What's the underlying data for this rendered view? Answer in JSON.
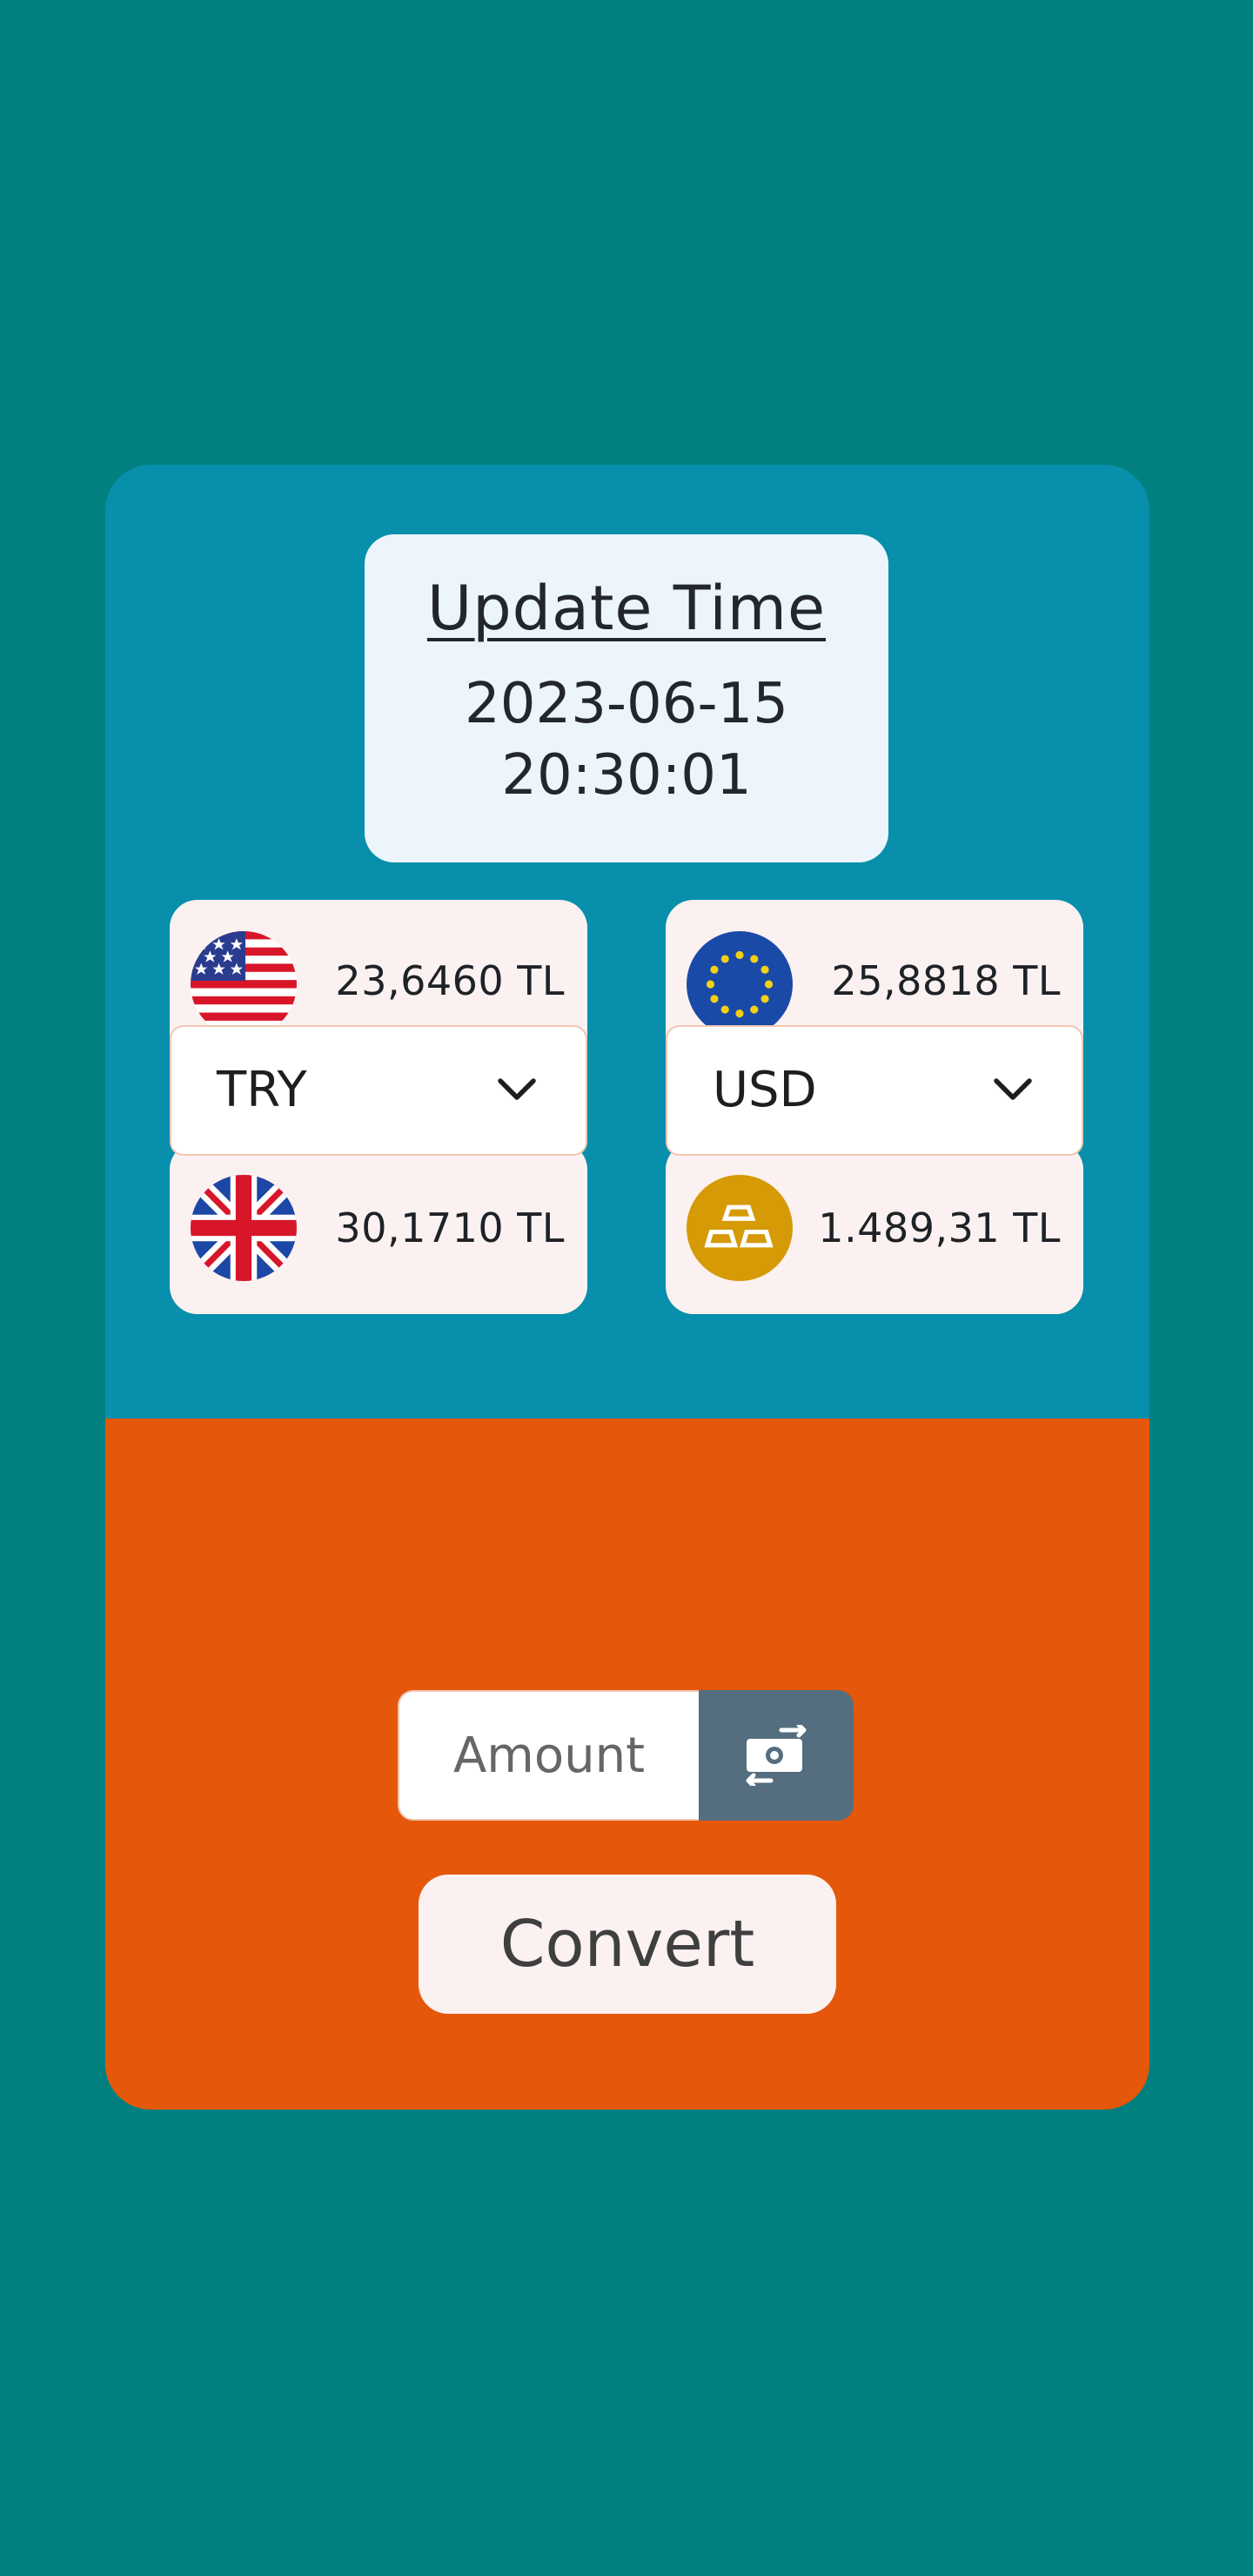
{
  "update": {
    "title": "Update Time",
    "date": "2023-06-15",
    "time": "20:30:01"
  },
  "rates": [
    {
      "currency": "USD",
      "icon": "us-flag-icon",
      "value": "23,6460 TL"
    },
    {
      "currency": "EUR",
      "icon": "eu-flag-icon",
      "value": "25,8818 TL"
    },
    {
      "currency": "GBP",
      "icon": "uk-flag-icon",
      "value": "30,1710 TL"
    },
    {
      "currency": "GOLD",
      "icon": "gold-bars-icon",
      "value": "1.489,31 TL"
    }
  ],
  "converter": {
    "from": "TRY",
    "to": "USD",
    "amount_placeholder": "Amount",
    "amount_value": "",
    "convert_label": "Convert"
  },
  "colors": {
    "background": "#028080",
    "top_panel": "#078FAB",
    "bottom_panel": "#E5570A",
    "card_fill": "#FCF1F1",
    "update_box": "#ECF5FC",
    "addon": "#546E7F",
    "gold": "#D59A05"
  }
}
